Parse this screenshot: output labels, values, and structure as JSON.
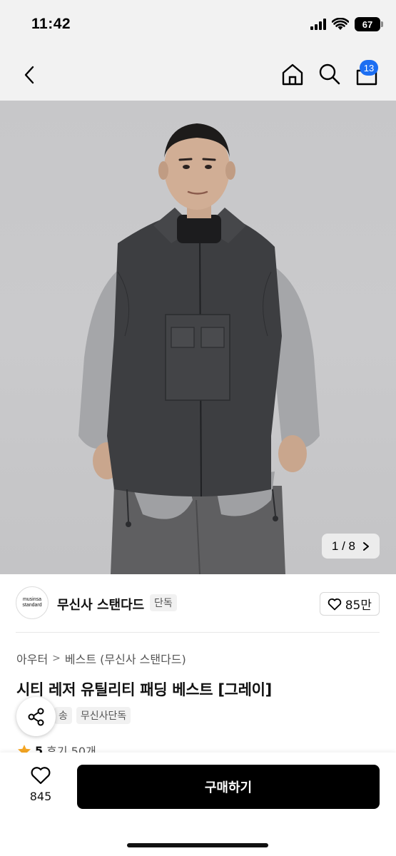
{
  "status_bar": {
    "time": "11:42",
    "battery": "67",
    "icons": [
      "signal-icon",
      "wifi-icon",
      "battery-icon"
    ]
  },
  "nav": {
    "back_icon": "chevron-left-icon",
    "home_icon": "home-icon",
    "search_icon": "search-icon",
    "cart_icon": "cart-icon",
    "cart_count": "13"
  },
  "hero": {
    "image_counter": "1 / 8",
    "counter_icon": "chevron-right-icon"
  },
  "brand": {
    "logo_line1": "musinsa",
    "logo_line2": "standard",
    "name": "무신사 스탠다드",
    "tag": "단독",
    "like_count": "85만"
  },
  "breadcrumb": {
    "items": [
      "아우터",
      "베스트 (무신사 스탠다드)"
    ],
    "separator": ">"
  },
  "product": {
    "title": "시티 레저 유틸리티 패딩 베스트 [그레이]",
    "tags": [
      "송",
      "무신사단독"
    ],
    "rating": "5",
    "review_text": "후기 50개"
  },
  "bottom": {
    "wish_count": "845",
    "buy_label": "구매하기"
  },
  "colors": {
    "accent": "#1c6ef2",
    "star": "#f5a623",
    "buy_button": "#000000"
  }
}
